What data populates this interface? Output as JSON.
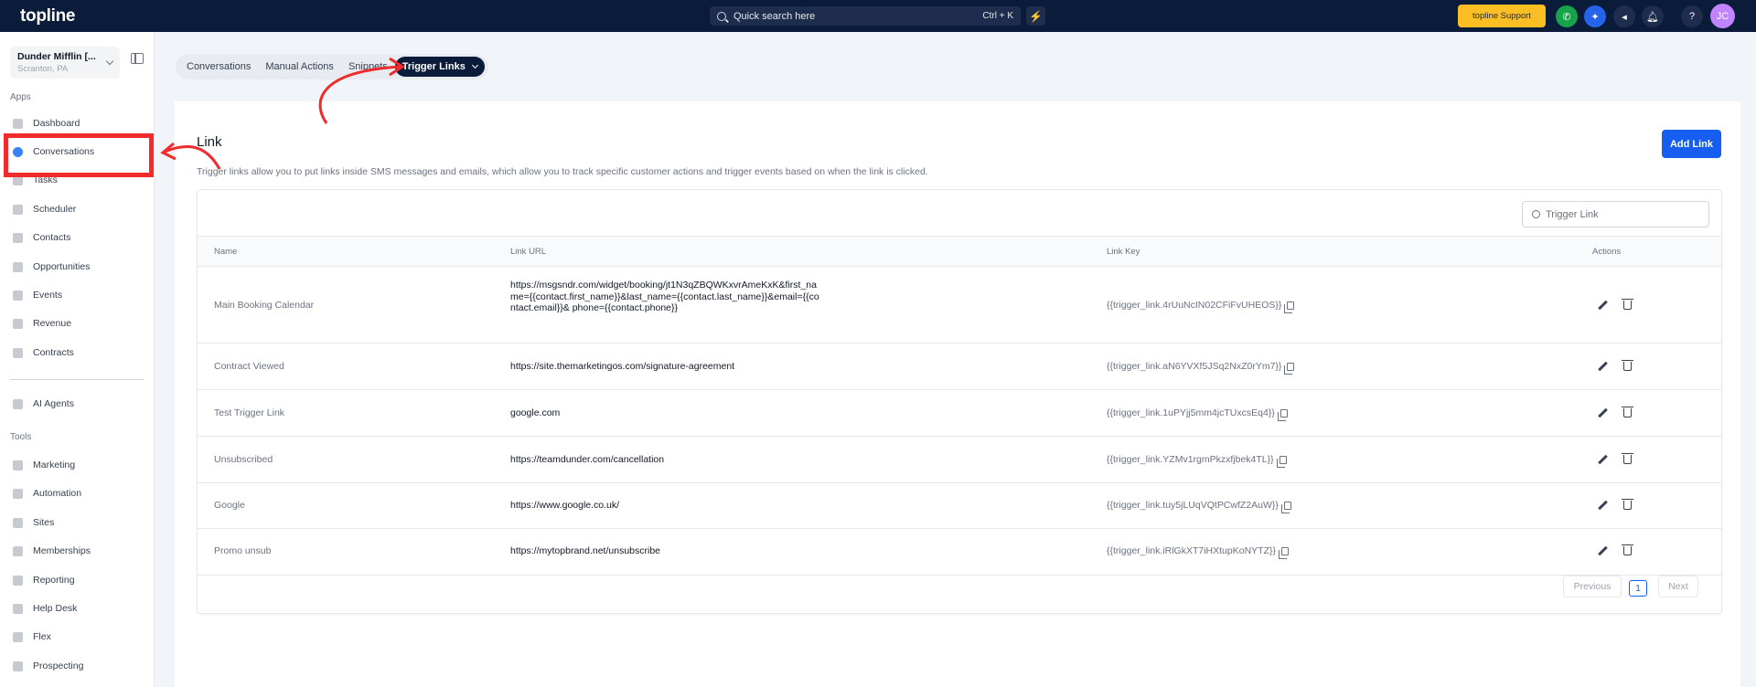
{
  "topbar": {
    "logo": "topline",
    "search_placeholder": "Quick search here",
    "search_shortcut": "Ctrl + K",
    "support_label": "topline Support",
    "avatar_initials": "JC",
    "colors": {
      "bg": "#0b1b3a",
      "support": "#fbbf24",
      "phone": "#16a34a",
      "blue": "#2563eb"
    }
  },
  "sidebar": {
    "location_name": "Dunder Mifflin [...",
    "location_sub": "Scranton, PA",
    "apps_label": "Apps",
    "tools_label": "Tools",
    "apps": [
      {
        "label": "Dashboard",
        "icon": "dashboard-icon"
      },
      {
        "label": "Conversations",
        "icon": "conversations-icon"
      },
      {
        "label": "Tasks",
        "icon": "tasks-icon"
      },
      {
        "label": "Scheduler",
        "icon": "calendar-icon"
      },
      {
        "label": "Contacts",
        "icon": "user-icon"
      },
      {
        "label": "Opportunities",
        "icon": "opportunities-icon"
      },
      {
        "label": "Events",
        "icon": "events-icon"
      },
      {
        "label": "Revenue",
        "icon": "revenue-icon"
      },
      {
        "label": "Contracts",
        "icon": "contracts-icon"
      }
    ],
    "ai_agents": "AI Agents",
    "tools": [
      {
        "label": "Marketing",
        "icon": "megaphone-icon"
      },
      {
        "label": "Automation",
        "icon": "automation-icon"
      },
      {
        "label": "Sites",
        "icon": "sites-icon"
      },
      {
        "label": "Memberships",
        "icon": "memberships-icon"
      },
      {
        "label": "Reporting",
        "icon": "reporting-icon"
      },
      {
        "label": "Help Desk",
        "icon": "help-icon"
      },
      {
        "label": "Flex",
        "icon": "flex-icon"
      },
      {
        "label": "Prospecting",
        "icon": "prospecting-icon"
      }
    ]
  },
  "tabs": [
    "Conversations",
    "Manual Actions",
    "Snippets",
    "Trigger Links"
  ],
  "main": {
    "title": "Link",
    "description": "Trigger links allow you to put links inside SMS messages and emails, which allow you to track specific customer actions and trigger events based on when the link is clicked.",
    "add_button": "Add Link",
    "filter_placeholder": "Trigger Link",
    "columns": [
      "Name",
      "Link URL",
      "Link Key",
      "Actions"
    ],
    "rows": [
      {
        "name": "Main Booking Calendar",
        "url": "https://msgsndr.com/widget/booking/jt1N3qZBQWKxvrAmeKxK&first_name={{contact.first_name}}&last_name={{contact.last_name}}&email={{contact.email}}& phone={{contact.phone}}",
        "key": "{{trigger_link.4rUuNcIN02CFiFvUHEOS}}"
      },
      {
        "name": "Contract Viewed",
        "url": "https://site.themarketingos.com/signature-agreement",
        "key": "{{trigger_link.aN6YVXf5JSq2NxZ0rYm7}}"
      },
      {
        "name": "Test Trigger Link",
        "url": "google.com",
        "key": "{{trigger_link.1uPYjj5mm4jcTUxcsEq4}}"
      },
      {
        "name": "Unsubscribed",
        "url": "https://teamdunder.com/cancellation",
        "key": "{{trigger_link.YZMv1rgmPkzxfjbek4TL}}"
      },
      {
        "name": "Google",
        "url": "https://www.google.co.uk/",
        "key": "{{trigger_link.tuy5jLUqVQtPCwfZ2AuW}}"
      },
      {
        "name": "Promo unsub",
        "url": "https://mytopbrand.net/unsubscribe",
        "key": "{{trigger_link.iRlGkXT7iHXtupKoNYTZ}}"
      }
    ],
    "pagination": {
      "previous": "Previous",
      "page": "1",
      "next": "Next"
    }
  }
}
